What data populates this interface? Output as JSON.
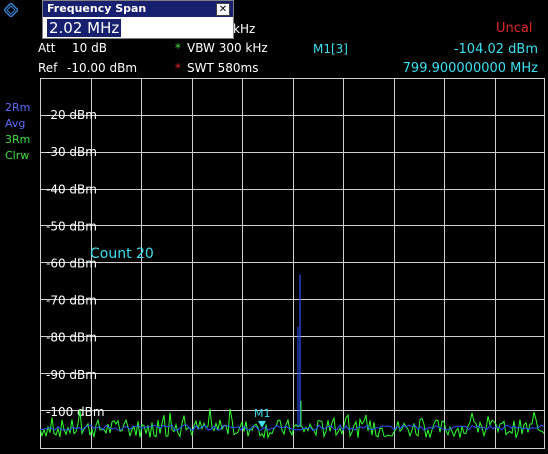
{
  "dialog": {
    "title": "Frequency Span",
    "value": "2.02 MHz",
    "close_glyph": "✕"
  },
  "header": {
    "partial_unit": "kHz",
    "uncal": "Uncal",
    "att_label": "Att",
    "att_value": "10 dB",
    "ref_label": "Ref",
    "ref_value": "-10.00 dBm",
    "vbw_star": "*",
    "vbw": "VBW 300 kHz",
    "swt_star": "*",
    "swt": "SWT 580ms",
    "marker_name": "M1[3]",
    "marker_level": "-104.02 dBm",
    "marker_freq": "799.900000000 MHz"
  },
  "side": {
    "trace2_id": "2Rm",
    "trace2_mode": "Avg",
    "trace3_id": "3Rm",
    "trace3_mode": "Clrw"
  },
  "count_label": "Count 20",
  "marker_label": "M1",
  "colors": {
    "trace_avg": "#3050ff",
    "trace_clrw": "#30ff30",
    "grid": "#d0d0d0",
    "text_cyan": "#3fe0f0",
    "uncal": "#e02828"
  },
  "chart_data": {
    "type": "line",
    "y_unit": "dBm",
    "ylabels": [
      "-20 dBm",
      "-30 dBm",
      "-40 dBm",
      "-50 dBm",
      "-60 dBm",
      "-70 dBm",
      "-80 dBm",
      "-90 dBm",
      "-100 dBm"
    ],
    "y_values": [
      -20,
      -30,
      -40,
      -50,
      -60,
      -70,
      -80,
      -90,
      -100
    ],
    "ylim": [
      -110,
      -10
    ],
    "grid": true,
    "x_divisions": 10,
    "series": [
      {
        "color": "#3050ff",
        "noise_floor": -104,
        "peak_level": -63,
        "peak_position_fraction": 0.515
      },
      {
        "color": "#30ff30",
        "noise_floor": -104,
        "noise_max": -100,
        "peak_level": -99
      }
    ],
    "marker": {
      "level": -104.02,
      "position_fraction": 0.44
    }
  }
}
